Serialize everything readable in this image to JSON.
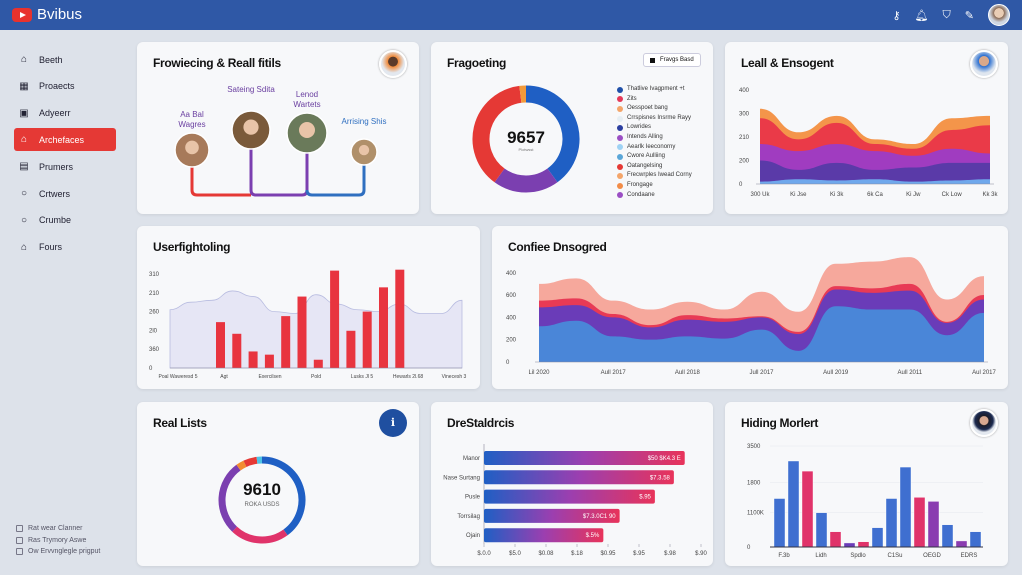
{
  "app": {
    "title": "Bvibus",
    "icons": [
      "key-icon",
      "bell-icon",
      "shield-icon",
      "pencil-icon"
    ]
  },
  "sidebar": {
    "items": [
      {
        "label": "Beeth",
        "icon": "home-icon"
      },
      {
        "label": "Proaects",
        "icon": "grid-icon"
      },
      {
        "label": "Adyeerr",
        "icon": "briefcase-icon"
      },
      {
        "label": "Archefaces",
        "icon": "house-icon",
        "active": true
      },
      {
        "label": "Prumers",
        "icon": "card-icon"
      },
      {
        "label": "Crtwers",
        "icon": "circle-icon"
      },
      {
        "label": "Crumbe",
        "icon": "circle-icon"
      },
      {
        "label": "Fours",
        "icon": "home-icon"
      }
    ],
    "checkboxes": [
      "Rat wear Clanner",
      "Ras Trymory Aswe",
      "Ow Ervvnglegle prigput"
    ]
  },
  "cards": {
    "network": {
      "title": "Frowiecing & Reall fitils",
      "people": [
        {
          "label": "Aa Bal Wagres",
          "color": "#6a3fa0"
        },
        {
          "label": "Sateing Sdita",
          "color": "#6a3fa0"
        },
        {
          "label": "Lenod Wartets",
          "color": "#6a3fa0"
        },
        {
          "label": "Arrising Shis",
          "color": "#2f6fc0"
        }
      ],
      "line_colors": [
        "#e53935",
        "#7b3fb0",
        "#7b3fb0",
        "#2f6fc0"
      ]
    },
    "donut1": {
      "title": "Fragoeting",
      "button": "Fravgs Basd",
      "center": "9657",
      "sub": "Plotwsst"
    },
    "area1": {
      "title": "Leall & Ensogent"
    },
    "bars1": {
      "title": "Userfightoling"
    },
    "area2": {
      "title": "Confiee Dnsogred"
    },
    "donut2": {
      "title": "Real Lists",
      "center": "9610",
      "sub": "ROKA USDS"
    },
    "hbar": {
      "title": "DreStaldrcis"
    },
    "grouped": {
      "title": "Hiding Morlert"
    }
  },
  "chart_data": [
    {
      "id": "donut1",
      "type": "pie",
      "values": [
        40,
        20,
        38,
        2
      ],
      "colors": [
        "#1f5fc4",
        "#7b3fb0",
        "#e53935",
        "#f29a3a"
      ],
      "legend": [
        {
          "label": "Thatlive Ivagpment +t",
          "color": "#1f4fa8"
        },
        {
          "label": "Zits",
          "color": "#e53958"
        },
        {
          "label": "Oesspoet bang",
          "color": "#f4a56a"
        },
        {
          "label": "Crrspisnes Insrme Rayy",
          "color": "#e6eef3"
        },
        {
          "label": "Lowrides",
          "color": "#2c3fa0"
        },
        {
          "label": "Intends Alling",
          "color": "#9b4fc4"
        },
        {
          "label": "Aearlk Ieeconorny",
          "color": "#9ed2f4"
        },
        {
          "label": "Cwore Aulliing",
          "color": "#5aa6d8"
        },
        {
          "label": "Oatangelsing",
          "color": "#e53935"
        },
        {
          "label": "Frecwrples Iwead Corny",
          "color": "#f4a56a"
        },
        {
          "label": "Frongage",
          "color": "#f28c48"
        },
        {
          "label": "Condaane",
          "color": "#9b4fc4"
        }
      ]
    },
    {
      "id": "area1",
      "type": "area",
      "stacked": true,
      "ylim": [
        0,
        400
      ],
      "yticks": [
        "0",
        "200",
        "210",
        "300",
        "400"
      ],
      "xticks": [
        "300 Uk",
        "Ki Jse",
        "Ki 3k",
        "6k Ca",
        "Ki Jw",
        "Ck Low",
        "Kk 3k"
      ],
      "series": [
        {
          "color": "#6fa8ec",
          "values": [
            10,
            20,
            15,
            20,
            10,
            15,
            20
          ]
        },
        {
          "color": "#5a3aa8",
          "values": [
            90,
            40,
            75,
            40,
            60,
            75,
            70
          ]
        },
        {
          "color": "#a03cc0",
          "values": [
            70,
            80,
            80,
            80,
            50,
            60,
            40
          ]
        },
        {
          "color": "#ea3a48",
          "values": [
            110,
            50,
            90,
            30,
            30,
            80,
            120
          ]
        },
        {
          "color": "#f4954a",
          "values": [
            40,
            30,
            30,
            20,
            20,
            50,
            40
          ]
        }
      ]
    },
    {
      "id": "bars1",
      "type": "bar",
      "ylim": [
        0,
        5
      ],
      "yticks": [
        "0",
        "360",
        "2l0",
        "260",
        "210",
        "310"
      ],
      "xticks": [
        "Poal Waweresd 5",
        "Agt",
        "Exercilsen",
        "Pold",
        "Lusks Jl 5",
        "Hewarls 2l.68",
        "Vinecesh 3"
      ],
      "values": [
        2.44,
        1.82,
        0.88,
        0.71,
        2.76,
        3.8,
        0.44,
        5.18,
        1.98,
        3.0,
        4.29,
        5.23
      ],
      "color": "#e8343f",
      "background": {
        "color": "#e6e6f5",
        "values": [
          3.1,
          3.5,
          3.6,
          4.1,
          3.8,
          3.0,
          2.9,
          3.9,
          3.4,
          3.1,
          3.0,
          3.4,
          2.9,
          2.9,
          3.6
        ]
      }
    },
    {
      "id": "area2",
      "type": "area",
      "stacked": true,
      "ylim": [
        0,
        950
      ],
      "yticks": [
        "0",
        "200",
        "400",
        "600",
        "400"
      ],
      "xticks": [
        "Lil 2020",
        "Aull 2017",
        "Aull 2018",
        "Jull 2017",
        "Aull 2019",
        "Aull 2011",
        "Aul 2017"
      ],
      "series": [
        {
          "color": "#4a86d8",
          "values": [
            320,
            370,
            230,
            200,
            230,
            210,
            290,
            100,
            500,
            470,
            470,
            240,
            440
          ]
        },
        {
          "color": "#6a3cb8",
          "values": [
            170,
            140,
            170,
            110,
            150,
            150,
            110,
            150,
            150,
            150,
            170,
            110,
            120
          ]
        },
        {
          "color": "#e83a55",
          "values": [
            60,
            60,
            30,
            20,
            40,
            30,
            10,
            20,
            30,
            40,
            60,
            10,
            40
          ]
        },
        {
          "color": "#f6a89c",
          "values": [
            150,
            180,
            120,
            140,
            120,
            80,
            220,
            180,
            200,
            240,
            240,
            200,
            170
          ]
        }
      ]
    },
    {
      "id": "donut2",
      "type": "pie",
      "values": [
        40,
        22,
        28,
        3,
        5,
        2
      ],
      "colors": [
        "#1f5fc4",
        "#e0336a",
        "#7b3fb0",
        "#f28c30",
        "#e53935",
        "#4ec3e6"
      ]
    },
    {
      "id": "hbar",
      "type": "bar",
      "orientation": "horizontal",
      "xlim": [
        0,
        8
      ],
      "categories": [
        "Manor",
        "Nase Surtang",
        "Pusle",
        "Torrsilag",
        "Ojain"
      ],
      "values": [
        7.4,
        7.0,
        6.3,
        5.0,
        4.4
      ],
      "data_labels": [
        "$50 $K4.3 E",
        "$7.3.58",
        "$.95",
        "$7.3.0C1 90",
        "$.5%"
      ],
      "xticks": [
        "$.0.0",
        "$5.0",
        "$0.08",
        "$.18",
        "$0.95",
        "$.95",
        "$.98",
        "$.90"
      ]
    },
    {
      "id": "grouped",
      "type": "bar",
      "ylim": [
        0,
        3500
      ],
      "yticks": [
        "0",
        "1100K",
        "1800",
        "3500"
      ],
      "xticks": [
        "F.3b",
        "Lidh",
        "Spdlo",
        "C1Su",
        "OEGD",
        "EDRS"
      ],
      "values": [
        1680,
        2980,
        2630,
        1190,
        530,
        140,
        180,
        670,
        1680,
        2770,
        1720,
        1580,
        770,
        210,
        530
      ],
      "colors": [
        "#3f6fd0",
        "#3f6fd0",
        "#e0336a",
        "#3f6fd0",
        "#e0336a",
        "#6a3cb8",
        "#e0336a",
        "#3f6fd0",
        "#3f6fd0",
        "#3f6fd0",
        "#e0336a",
        "#8a3cb0",
        "#3f6fd0",
        "#8a3cb0",
        "#3f6fd0"
      ]
    }
  ]
}
